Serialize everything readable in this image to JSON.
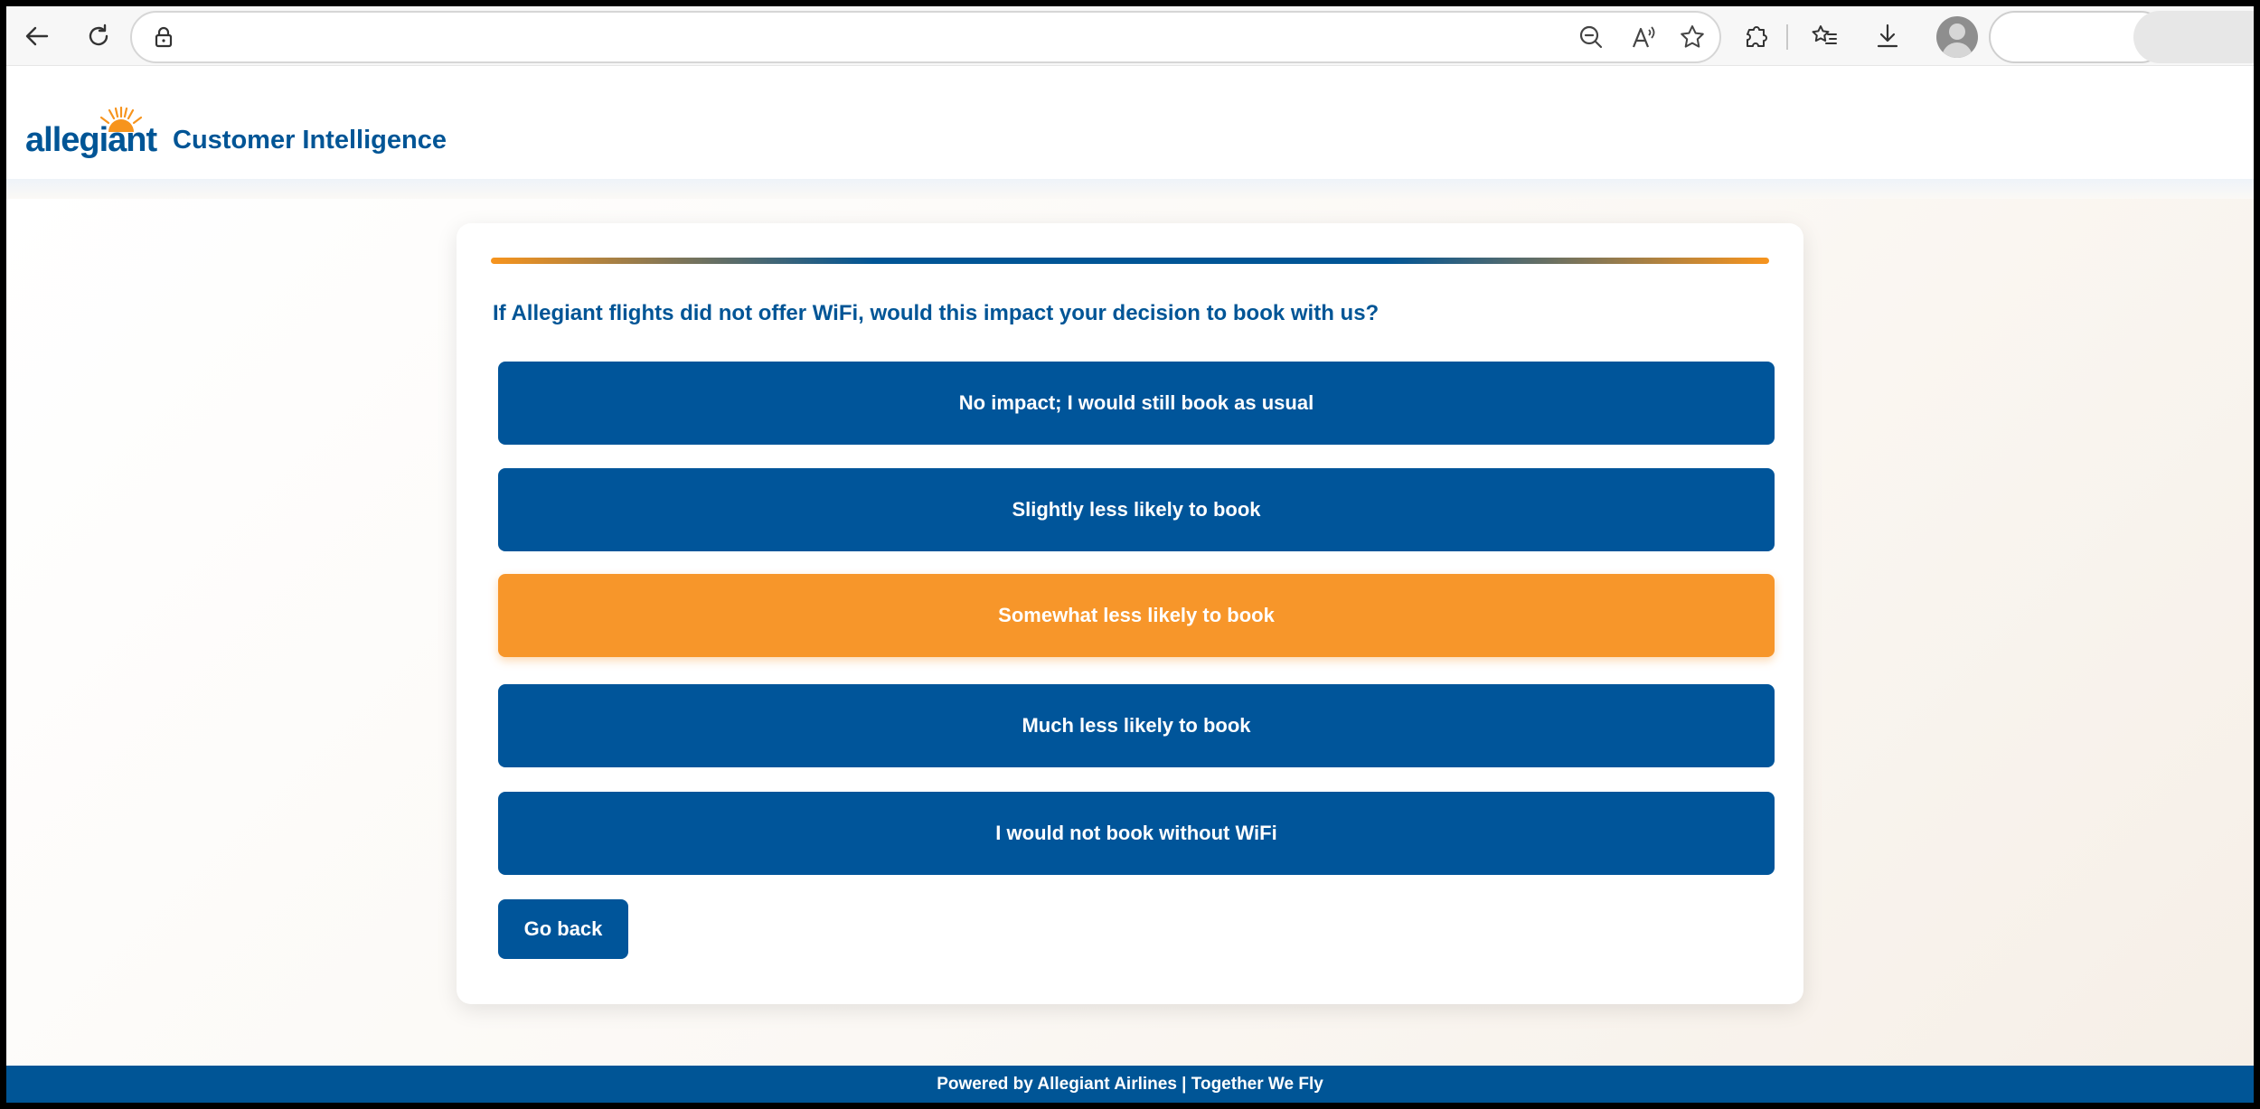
{
  "browser": {
    "address_value": "",
    "icons": [
      "back-icon",
      "refresh-icon",
      "lock-icon",
      "zoom-out-icon",
      "read-aloud-icon",
      "favorite-star-icon",
      "extensions-icon",
      "favorites-icon",
      "download-icon",
      "profile-icon"
    ]
  },
  "header": {
    "logo_text": "allegiant",
    "title": "Customer Intelligence"
  },
  "survey": {
    "question": "If Allegiant flights did not offer WiFi, would this impact your decision to book with us?",
    "options": [
      "No impact; I would still book as usual",
      "Slightly less likely to book",
      "Somewhat less likely to book",
      "Much less likely to book",
      "I would not book without WiFi"
    ],
    "selected_option": "Somewhat less likely to book",
    "go_back_label": "Go back"
  },
  "footer": {
    "text": "Powered by Allegiant Airlines | Together We Fly"
  },
  "colors": {
    "brand_blue": "#005596",
    "accent_orange": "#f7941d",
    "selected_orange": "#f7962a"
  }
}
